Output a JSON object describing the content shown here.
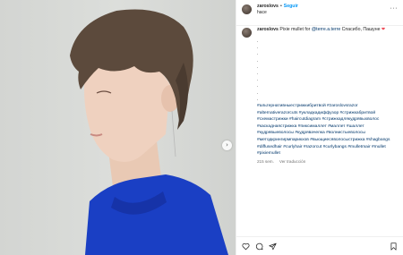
{
  "header": {
    "username": "zaroslovs",
    "separator": "•",
    "follow_label": "Seguir",
    "subtitle": "hace"
  },
  "header_more_icon": "more-horizontal-icon",
  "caption": {
    "username": "zaroslovs",
    "text_before": "Pixie mullet for ",
    "mention": "@terre.a.terre",
    "text_after": " Спасибо, Пашуне ",
    "emoji": "❤"
  },
  "dots": [
    ".",
    ".",
    ".",
    ".",
    ".",
    ".",
    ".",
    ".",
    ".",
    "."
  ],
  "hashtags": [
    "#альтернативныестрижкибритвой",
    "#zaroslovsrazor",
    "#alternativerazorcuts",
    "#укладкадиффузор",
    "#стрижкабритвой",
    "#схемастрижки",
    "#haircutdiagram",
    "#стрижкадлякудрявыхволос",
    "#каскаднаястрижка",
    "#пиксималлет",
    "#маллет",
    "#шаллет",
    "#кудрявыеволосы",
    "#кудрявачелка",
    "#волнистыеволосы",
    "#методкрингирмпарикхов",
    "#вьющиесяволосыстрижка",
    "#shagbangs",
    "#diffusedhair",
    "#curlyhair",
    "#razorcut",
    "#curlybangs",
    "#mulletmair",
    "#mullet",
    "#pixiemullet"
  ],
  "meta": {
    "time": "215 sem.",
    "translate": "Ver traducción"
  },
  "icons": {
    "like": "heart-icon",
    "comment": "comment-icon",
    "share": "send-icon",
    "save": "bookmark-icon",
    "next": "chevron-right-icon"
  },
  "colors": {
    "link": "#00376b",
    "follow": "#0095f6",
    "heart": "#ed4956",
    "top_blue": "#1a3fc4",
    "hair": "#5c4a3c"
  }
}
